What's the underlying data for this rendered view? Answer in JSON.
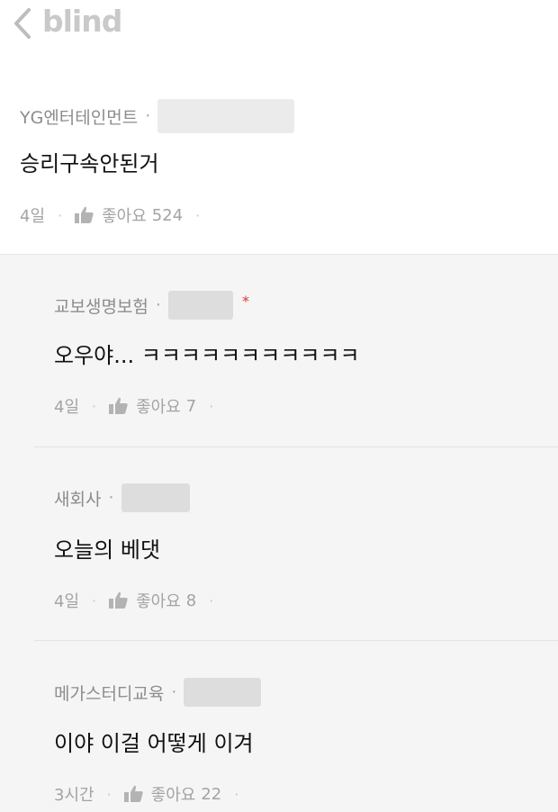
{
  "app": {
    "logo": "blind"
  },
  "post": {
    "company": "YG엔터테인먼트",
    "body": "승리구속안된거",
    "time": "4일",
    "like_label": "좋아요",
    "like_count": "524"
  },
  "comments": [
    {
      "company": "교보생명보험",
      "body": "오우야... ㅋㅋㅋㅋㅋㅋㅋㅋㅋㅋㅋ",
      "time": "4일",
      "like_label": "좋아요",
      "like_count": "7",
      "star": "*"
    },
    {
      "company": "새회사",
      "body": "오늘의 베댓",
      "time": "4일",
      "like_label": "좋아요",
      "like_count": "8"
    },
    {
      "company": "메가스터디교육",
      "body": "이야 이걸 어떻게 이겨",
      "time": "3시간",
      "like_label": "좋아요",
      "like_count": "22"
    }
  ],
  "colors": {
    "accent_star": "#dd3333",
    "logo": "#c9c9c9",
    "comment_bg": "#f5f5f5"
  },
  "icons": [
    "back-chevron-icon",
    "thumbs-up-icon"
  ]
}
